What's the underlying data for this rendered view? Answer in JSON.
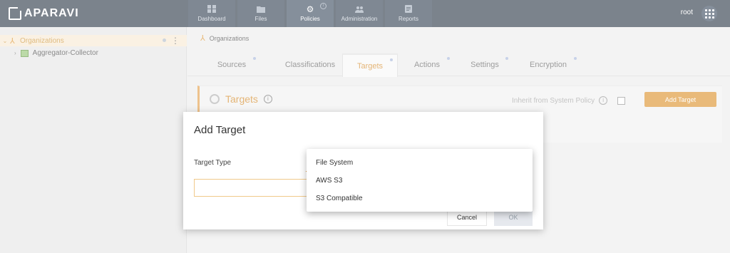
{
  "app": {
    "logo_text": "APARAVI"
  },
  "nav": {
    "items": [
      {
        "label": "Dashboard",
        "icon": "dashboard-icon"
      },
      {
        "label": "Files",
        "icon": "folder-icon"
      },
      {
        "label": "Policies",
        "icon": "gear-icon"
      },
      {
        "label": "Administration",
        "icon": "users-icon"
      },
      {
        "label": "Reports",
        "icon": "report-icon"
      }
    ],
    "active": "Policies"
  },
  "header": {
    "user": "root"
  },
  "sidebar": {
    "root": {
      "label": "Organizations"
    },
    "child": {
      "label": "Aggregator-Collector"
    }
  },
  "breadcrumb": {
    "label": "Organizations"
  },
  "tabs": [
    {
      "label": "Sources"
    },
    {
      "label": "Classifications"
    },
    {
      "label": "Targets"
    },
    {
      "label": "Actions"
    },
    {
      "label": "Settings"
    },
    {
      "label": "Encryption"
    }
  ],
  "active_tab": "Targets",
  "panel": {
    "title": "Targets",
    "inherit_label": "Inherit from System Policy",
    "add_button": "Add Target"
  },
  "modal": {
    "title": "Add Target",
    "field_label": "Target Type",
    "input_value": "",
    "cancel_label": "Cancel",
    "ok_label": "OK"
  },
  "dropdown": {
    "options": [
      "File System",
      "AWS S3",
      "S3 Compatible"
    ]
  },
  "colors": {
    "topbar": "#1d2a3a",
    "accent": "#d9891a",
    "active_tab_text": "#d17f12"
  }
}
